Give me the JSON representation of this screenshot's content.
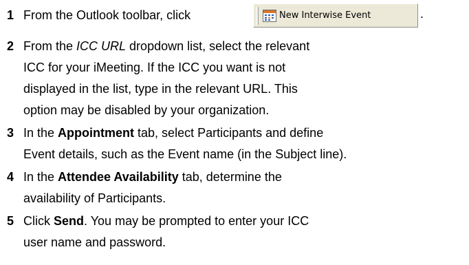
{
  "steps": [
    {
      "number": "1",
      "before_button": "From the Outlook toolbar, click",
      "button_label": "New Interwise Event",
      "button_icon": "calendar-icon",
      "after_button": "."
    },
    {
      "number": "2",
      "line1_pre": "From the ",
      "line1_italic": "ICC URL",
      "line1_post": " dropdown list, select the relevant",
      "line2": "ICC for your iMeeting. If the ICC you want is not",
      "line3": "displayed in the list, type in the relevant URL. This",
      "line4": "option may be disabled by your organization."
    },
    {
      "number": "3",
      "line1_pre": "In the ",
      "line1_bold": "Appointment",
      "line1_post": " tab, select Participants and define",
      "line2": "Event details, such as the Event name (in the Subject line)."
    },
    {
      "number": "4",
      "line1_pre": "In the ",
      "line1_bold": "Attendee Availability",
      "line1_post": " tab, determine the",
      "line2": "availability of Participants."
    },
    {
      "number": "5",
      "line1_pre": "Click ",
      "line1_bold": "Send",
      "line1_post": ". You may be prompted to enter your ICC",
      "line2": "user name and password."
    }
  ],
  "colors": {
    "text": "#000000",
    "button_face": "#ece9d8",
    "icon_orange": "#d9762a",
    "icon_blue": "#2b5fb8"
  }
}
